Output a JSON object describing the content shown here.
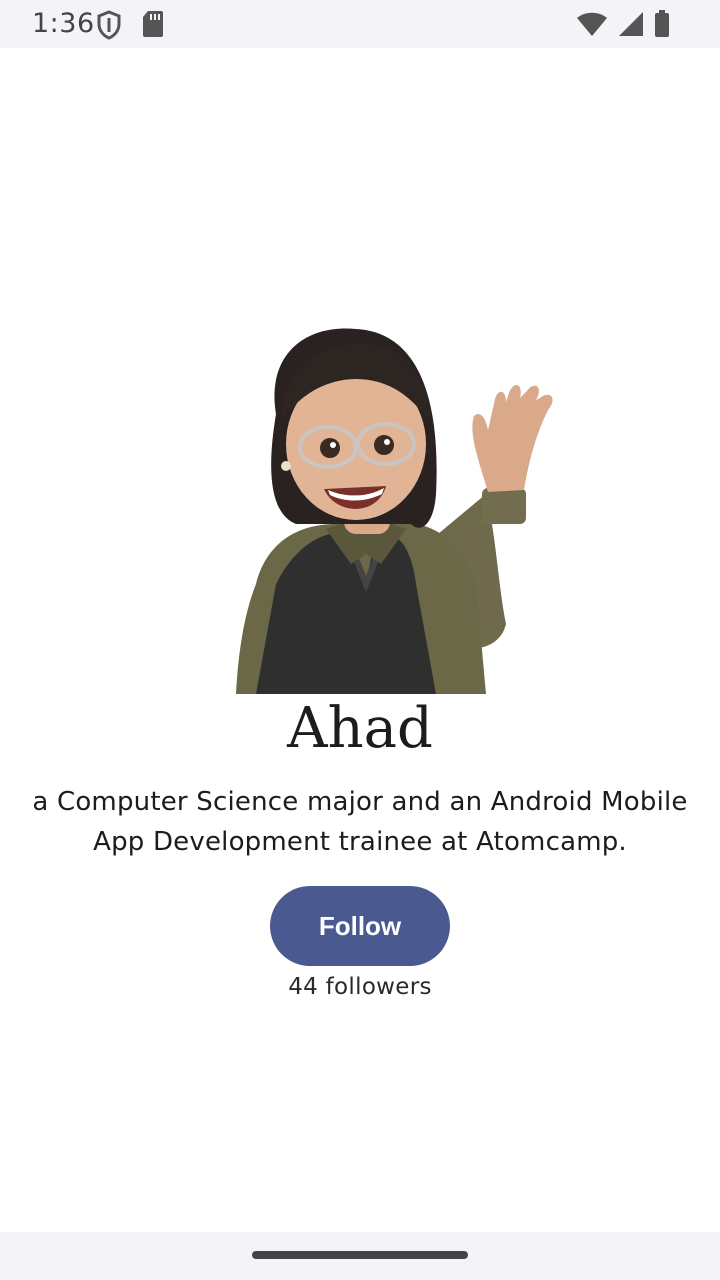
{
  "status_bar": {
    "time": "1:36",
    "icons": [
      "shield-icon",
      "sd-card-icon",
      "wifi-icon",
      "signal-icon",
      "battery-icon"
    ]
  },
  "profile": {
    "name": "Ahad",
    "bio": "a Computer Science major and an Android Mobile App Development trainee at Atomcamp.",
    "follow_label": "Follow",
    "followers_text": "44 followers",
    "avatar": "memoji-waving-avatar"
  },
  "colors": {
    "button": "#4a5a91",
    "background": "#ffffff",
    "system_bars": "#f4f3f8"
  }
}
